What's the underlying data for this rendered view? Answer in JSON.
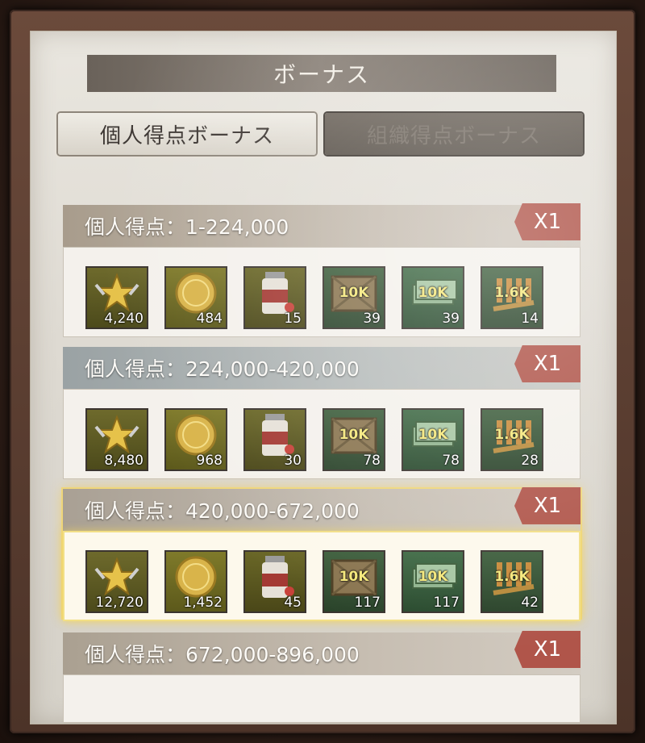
{
  "title": "ボーナス",
  "tabs": [
    {
      "label": "個人得点ボーナス",
      "active": true
    },
    {
      "label": "組織得点ボーナス",
      "active": false
    }
  ],
  "tiers": [
    {
      "label": "個人得点：1-224,000",
      "multiplier": "X1",
      "highlight": false,
      "items": [
        {
          "icon": "medal-star-icon",
          "count": "4,240"
        },
        {
          "icon": "gold-coin-icon",
          "count": "484"
        },
        {
          "icon": "pill-bottle-icon",
          "count": "15"
        },
        {
          "icon": "supply-crate-icon",
          "amount": "10K",
          "count": "39"
        },
        {
          "icon": "cash-stack-icon",
          "amount": "10K",
          "count": "39"
        },
        {
          "icon": "ammo-icon",
          "amount": "1.6K",
          "count": "14"
        }
      ]
    },
    {
      "label": "個人得点：224,000-420,000",
      "multiplier": "X1",
      "highlight": false,
      "items": [
        {
          "icon": "medal-star-icon",
          "count": "8,480"
        },
        {
          "icon": "gold-coin-icon",
          "count": "968"
        },
        {
          "icon": "pill-bottle-icon",
          "count": "30"
        },
        {
          "icon": "supply-crate-icon",
          "amount": "10K",
          "count": "78"
        },
        {
          "icon": "cash-stack-icon",
          "amount": "10K",
          "count": "78"
        },
        {
          "icon": "ammo-icon",
          "amount": "1.6K",
          "count": "28"
        }
      ]
    },
    {
      "label": "個人得点：420,000-672,000",
      "multiplier": "X1",
      "highlight": true,
      "items": [
        {
          "icon": "medal-star-icon",
          "count": "12,720"
        },
        {
          "icon": "gold-coin-icon",
          "count": "1,452"
        },
        {
          "icon": "pill-bottle-icon",
          "count": "45"
        },
        {
          "icon": "supply-crate-icon",
          "amount": "10K",
          "count": "117"
        },
        {
          "icon": "cash-stack-icon",
          "amount": "10K",
          "count": "117"
        },
        {
          "icon": "ammo-icon",
          "amount": "1.6K",
          "count": "42"
        }
      ]
    },
    {
      "label": "個人得点：672,000-896,000",
      "multiplier": "X1",
      "highlight": false,
      "items": []
    }
  ],
  "colors": {
    "multiplier_badge": "#b0554a",
    "highlight_glow": "#efd67a"
  }
}
